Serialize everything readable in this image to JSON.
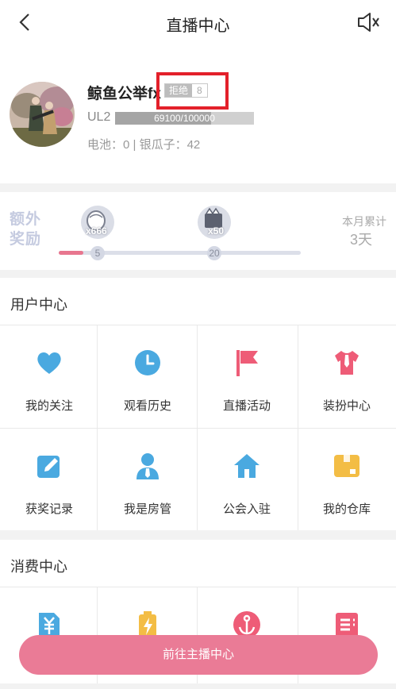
{
  "header": {
    "title": "直播中心",
    "back_icon": "chevron-left-icon",
    "sound_icon": "speaker-mute-icon"
  },
  "profile": {
    "username": "鲸鱼公举fx",
    "badge_label": "拒绝",
    "badge_count": "8",
    "level": "UL2",
    "exp_text": "69100/100000",
    "exp_progress": 0.691,
    "stats": "电池：0  |  银瓜子：42"
  },
  "reward": {
    "label": "额外奖励",
    "gift1_mult": "x666",
    "gift2_mult": "x50",
    "node1": "5",
    "node2": "20",
    "progress": 0.1,
    "month_label": "本月累计",
    "month_value": "3天"
  },
  "user_center": {
    "title": "用户中心",
    "items": [
      {
        "label": "我的关注",
        "icon": "heart-icon"
      },
      {
        "label": "观看历史",
        "icon": "clock-icon"
      },
      {
        "label": "直播活动",
        "icon": "flag-icon"
      },
      {
        "label": "装扮中心",
        "icon": "shirt-icon"
      },
      {
        "label": "获奖记录",
        "icon": "edit-icon"
      },
      {
        "label": "我是房管",
        "icon": "manager-icon"
      },
      {
        "label": "公会入驻",
        "icon": "house-icon"
      },
      {
        "label": "我的仓库",
        "icon": "box-icon"
      }
    ]
  },
  "consume_center": {
    "title": "消费中心",
    "items": [
      {
        "icon": "yuan-icon"
      },
      {
        "icon": "battery-icon"
      },
      {
        "icon": "anchor-icon"
      },
      {
        "icon": "list-icon"
      }
    ]
  },
  "cta": {
    "label": "前往主播中心"
  },
  "colors": {
    "accent": "#ea7b96",
    "blue": "#4aa9e0",
    "pink": "#ee5c77",
    "yellow": "#f3bd45",
    "highlight": "#e3202a"
  }
}
